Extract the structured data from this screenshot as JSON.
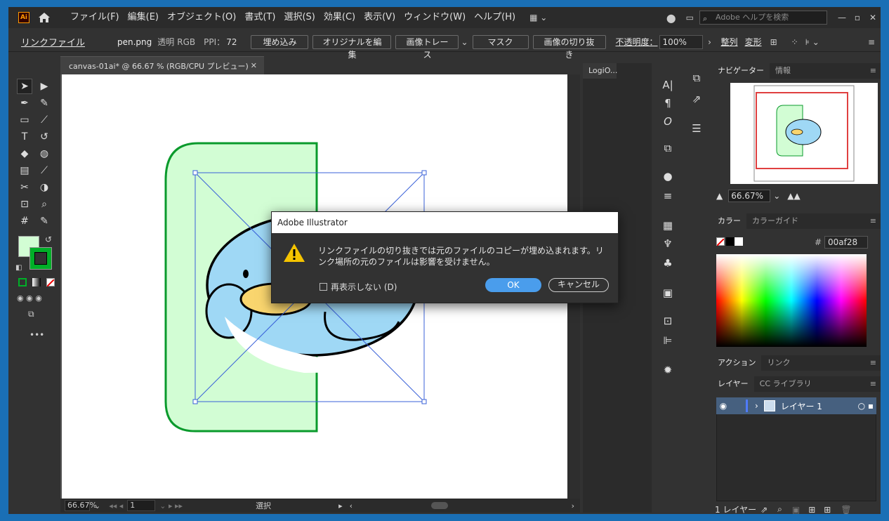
{
  "menubar": {
    "logo": "Ai",
    "items": [
      "ファイル(F)",
      "編集(E)",
      "オブジェクト(O)",
      "書式(T)",
      "選択(S)",
      "効果(C)",
      "表示(V)",
      "ウィンドウ(W)",
      "ヘルプ(H)"
    ],
    "search_placeholder": "Adobe ヘルプを検索"
  },
  "control": {
    "type_label": "リンクファイル",
    "filename": "pen.png",
    "transparency": "透明",
    "colormode": "RGB",
    "ppi_label": "PPI：",
    "ppi_value": "72",
    "embed": "埋め込み",
    "edit_original": "オリジナルを編集",
    "image_trace": "画像トレース",
    "mask": "マスク",
    "crop": "画像の切り抜き",
    "opacity_label": "不透明度：",
    "opacity_value": "100%",
    "align": "整列",
    "transform": "変形"
  },
  "document": {
    "tab_title": "canvas-01ai* @ 66.67 % (RGB/CPU プレビュー)",
    "zoom": "66.67%",
    "artboard": "1",
    "status": "選択"
  },
  "dialog": {
    "title": "Adobe Illustrator",
    "message_line1": "リンクファイルの切り抜きでは元のファイルのコピーが埋め込まれます。リ",
    "message_line2": "ンク場所の元のファイルは影響を受けません。",
    "checkbox": "再表示しない (D)",
    "ok": "OK",
    "cancel": "キャンセル"
  },
  "panels": {
    "logi_tab": "LogiO...",
    "navigator_tab": "ナビゲーター",
    "info_tab": "情報",
    "nav_zoom": "66.67%",
    "color_tab": "カラー",
    "color_guide_tab": "カラーガイド",
    "hex_label": "#",
    "hex_value": "00af28",
    "actions_tab": "アクション",
    "links_tab": "リンク",
    "layers_tab": "レイヤー",
    "cc_tab": "CC ライブラリ",
    "layer_name": "レイヤー 1",
    "layer_count": "1 レイヤー"
  },
  "colors": {
    "stroke": "#00af28",
    "fill": "#d2fdd4",
    "accent": "#4a9dec"
  }
}
